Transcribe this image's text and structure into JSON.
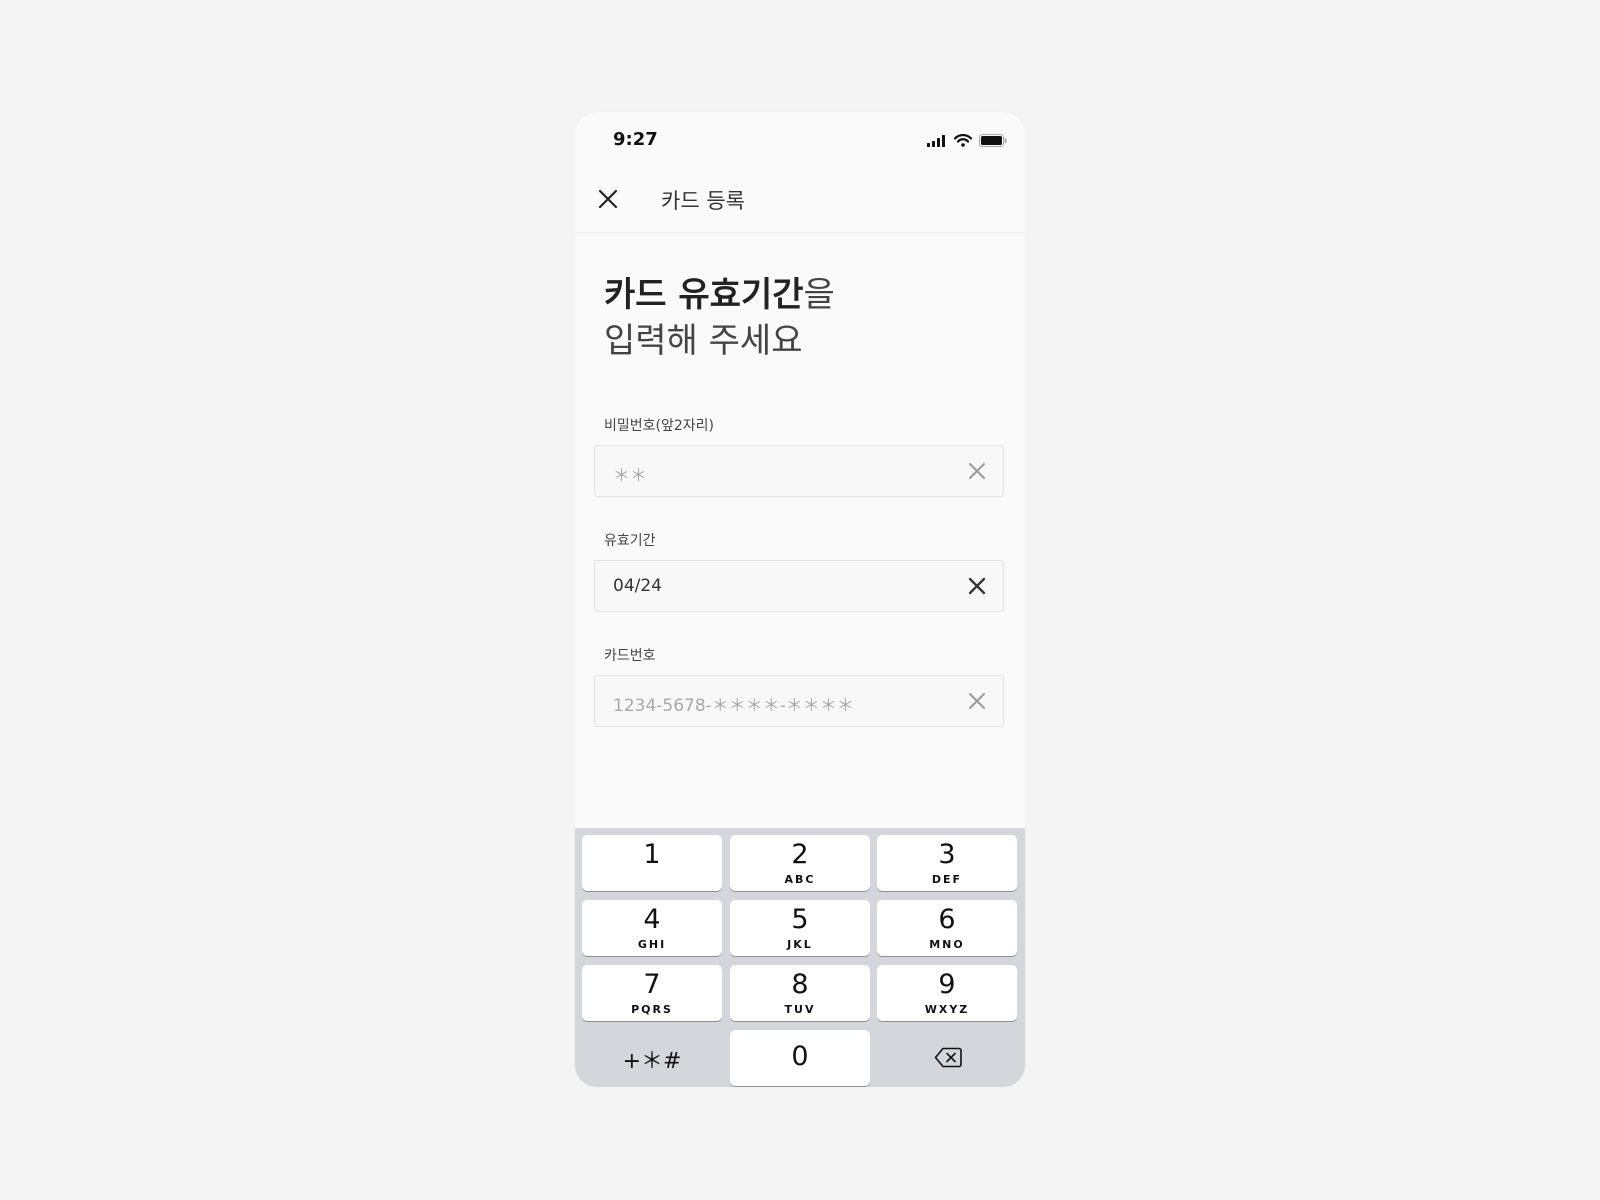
{
  "status_bar": {
    "time": "9:27",
    "icons": [
      "signal-icon",
      "wifi-icon",
      "battery-icon"
    ]
  },
  "nav": {
    "close_icon": "close-icon",
    "title": "카드 등록"
  },
  "heading": {
    "bold": "카드 유효기간",
    "suffix": "을",
    "line2": "입력해 주세요"
  },
  "fields": [
    {
      "label": "비밀번호(앞2자리)",
      "value": "＊＊",
      "state": "placeholder"
    },
    {
      "label": "유효기간",
      "value": "04/24",
      "state": "active"
    },
    {
      "label": "카드번호",
      "value": "1234-5678-＊＊＊＊-＊＊＊＊",
      "state": "placeholder"
    }
  ],
  "keypad": {
    "keys": [
      {
        "digit": "1",
        "letters": ""
      },
      {
        "digit": "2",
        "letters": "ABC"
      },
      {
        "digit": "3",
        "letters": "DEF"
      },
      {
        "digit": "4",
        "letters": "GHI"
      },
      {
        "digit": "5",
        "letters": "JKL"
      },
      {
        "digit": "6",
        "letters": "MNO"
      },
      {
        "digit": "7",
        "letters": "PQRS"
      },
      {
        "digit": "8",
        "letters": "TUV"
      },
      {
        "digit": "9",
        "letters": "WXYZ"
      },
      {
        "digit": "0",
        "letters": ""
      }
    ],
    "symbols_label": "+＊#",
    "delete_icon": "backspace-icon"
  },
  "colors": {
    "keypad_bg": "#d5d6db",
    "placeholder_text": "#a8a8a8",
    "active_text": "#333333"
  }
}
